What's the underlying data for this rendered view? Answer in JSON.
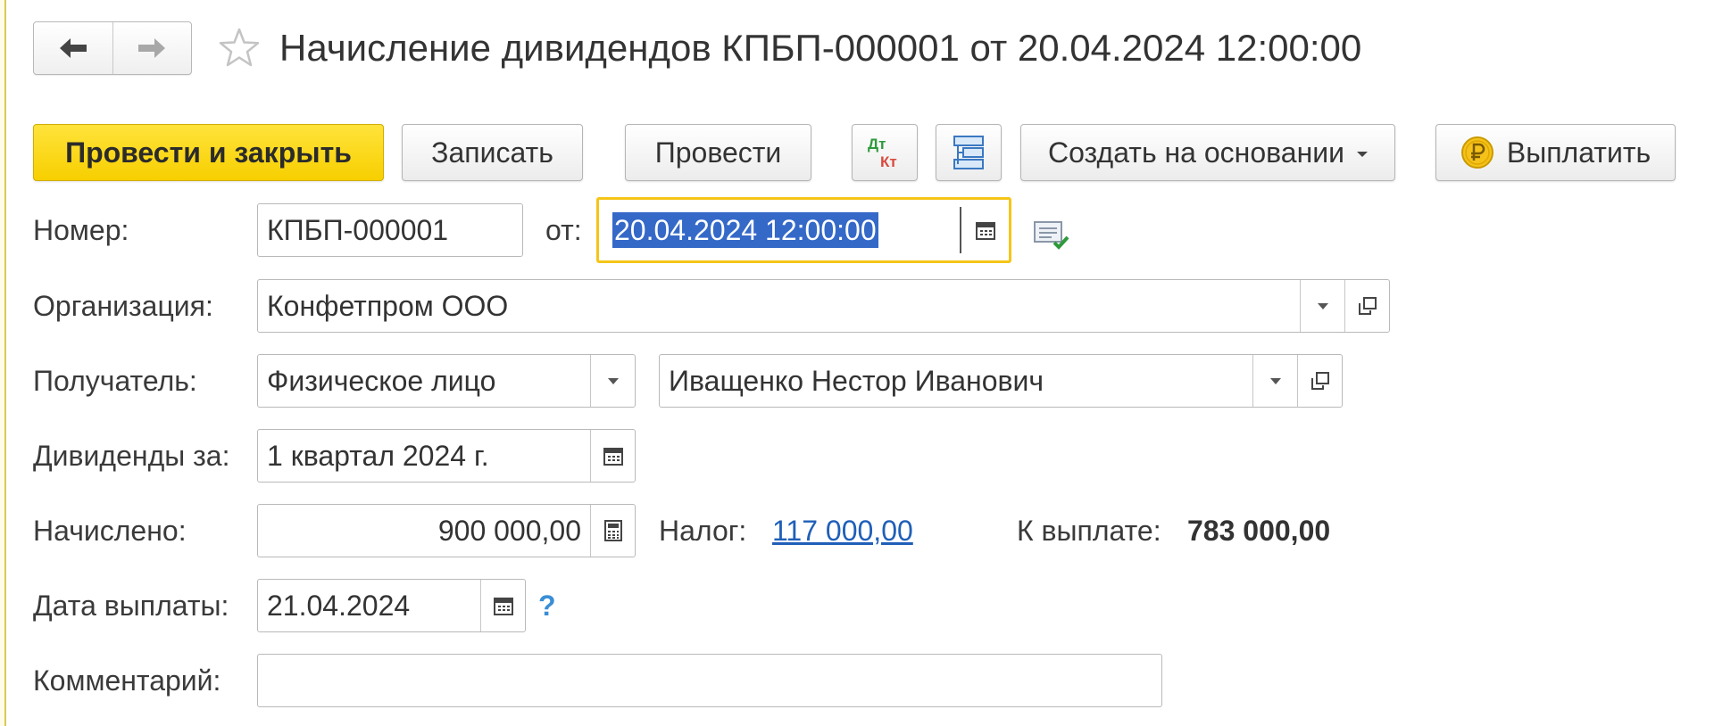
{
  "window": {
    "title": "Начисление дивидендов КПБП-000001 от 20.04.2024 12:00:00"
  },
  "nav": {
    "back_icon": "arrow-left-icon",
    "forward_icon": "arrow-right-icon",
    "favorite_icon": "star-icon"
  },
  "toolbar": {
    "post_close_label": "Провести и закрыть",
    "save_label": "Записать",
    "post_label": "Провести",
    "dtkt_icon_top": "Дт",
    "dtkt_icon_bottom": "Кт",
    "structure_icon": "structure-icon",
    "create_based_label": "Создать на основании",
    "pay_label": "Выплатить",
    "pay_icon": "ruble-coin-icon"
  },
  "form": {
    "number": {
      "label": "Номер:",
      "value": "КПБП-000001"
    },
    "date": {
      "label": "от:",
      "value": "20.04.2024 12:00:00"
    },
    "organization": {
      "label": "Организация:",
      "value": "Конфетпром ООО"
    },
    "recipient": {
      "label": "Получатель:",
      "type_value": "Физическое лицо",
      "value": "Иващенко Нестор Иванович"
    },
    "period": {
      "label": "Дивиденды за:",
      "value": "1 квартал 2024 г."
    },
    "accrued": {
      "label": "Начислено:",
      "value": "900 000,00"
    },
    "tax": {
      "label": "Налог:",
      "value": "117 000,00"
    },
    "to_pay": {
      "label": "К выплате:",
      "value": "783 000,00"
    },
    "payment_date": {
      "label": "Дата выплаты:",
      "value": "21.04.2024",
      "help": "?"
    },
    "comment": {
      "label": "Комментарий:",
      "value": ""
    }
  },
  "colors": {
    "primary_button": "#f7cf00",
    "selection": "#3569c8",
    "focus_border": "#f5c518",
    "link": "#1f5fb8",
    "help": "#3a8ed6"
  }
}
